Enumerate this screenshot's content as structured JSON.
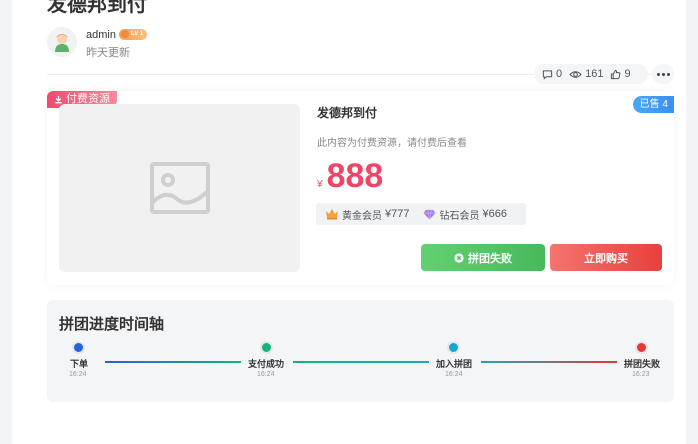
{
  "post": {
    "title": "发德邦到付",
    "author": "admin",
    "level": "LV 1",
    "updated": "昨天更新",
    "stats": {
      "comments": "0",
      "views": "161",
      "likes": "9"
    }
  },
  "product": {
    "paid_tag": "付费资源",
    "sold_tag": "已售 4",
    "title": "发德邦到付",
    "desc": "此内容为付费资源，请付费后查看",
    "currency": "¥",
    "price": "888",
    "members": [
      {
        "label": "黄金会员",
        "price": "¥777"
      },
      {
        "label": "钻石会员",
        "price": "¥666"
      }
    ],
    "group_button": "拼团失败",
    "buy_button": "立即购买"
  },
  "timeline": {
    "title": "拼团进度时间轴",
    "steps": [
      {
        "label": "下单",
        "time": "16:24",
        "color": "#2563d9"
      },
      {
        "label": "支付成功",
        "time": "16:24",
        "color": "#16b37a"
      },
      {
        "label": "加入拼团",
        "time": "16:24",
        "color": "#18a7c7"
      },
      {
        "label": "拼团失败",
        "time": "16:23",
        "color": "#e53935"
      }
    ]
  }
}
